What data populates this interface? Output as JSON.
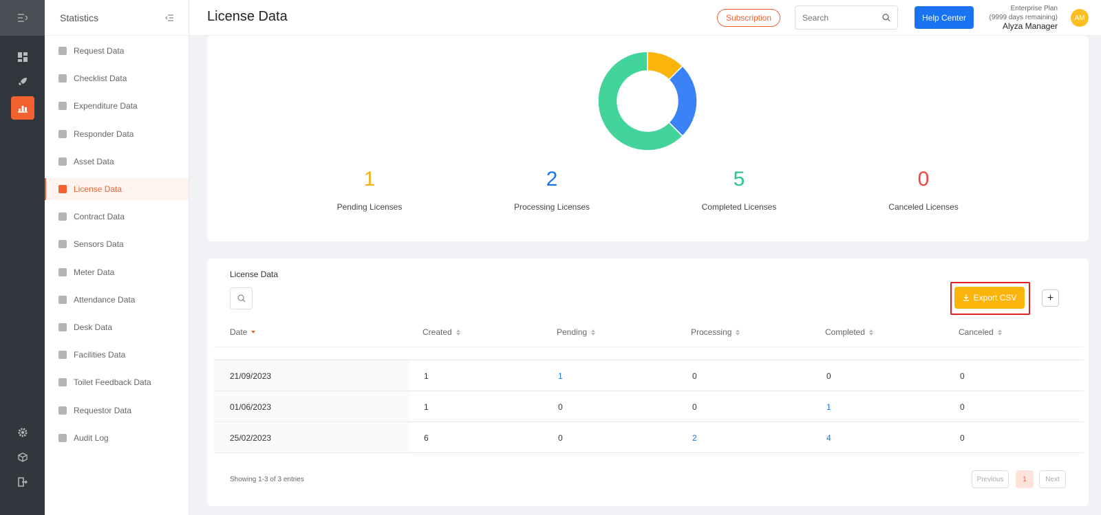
{
  "rail": {
    "icons": [
      "menu-unfold-icon",
      "dashboard-icon",
      "rocket-icon",
      "statistics-icon",
      "settings-icon",
      "cube-icon",
      "logout-icon"
    ]
  },
  "sidebar": {
    "title": "Statistics",
    "items": [
      {
        "label": "Request Data",
        "icon": "question-square-icon"
      },
      {
        "label": "Checklist Data",
        "icon": "checklist-icon"
      },
      {
        "label": "Expenditure Data",
        "icon": "wallet-icon"
      },
      {
        "label": "Responder Data",
        "icon": "users-icon"
      },
      {
        "label": "Asset Data",
        "icon": "box-icon"
      },
      {
        "label": "License Data",
        "icon": "shield-icon",
        "active": true
      },
      {
        "label": "Contract Data",
        "icon": "contract-icon"
      },
      {
        "label": "Sensors Data",
        "icon": "rss-icon"
      },
      {
        "label": "Meter Data",
        "icon": "gauge-icon"
      },
      {
        "label": "Attendance Data",
        "icon": "calendar-check-icon"
      },
      {
        "label": "Desk Data",
        "icon": "desk-icon"
      },
      {
        "label": "Facilities Data",
        "icon": "calendar-plus-icon"
      },
      {
        "label": "Toilet Feedback Data",
        "icon": "list-icon"
      },
      {
        "label": "Requestor Data",
        "icon": "smile-icon"
      },
      {
        "label": "Audit Log",
        "icon": "document-icon"
      }
    ]
  },
  "header": {
    "title": "License Data",
    "subscription_label": "Subscription",
    "search_placeholder": "Search",
    "help_label": "Help Center",
    "plan_name": "Enterprise Plan",
    "plan_days": "(9999 days remaining)",
    "user_name": "Alyza Manager",
    "avatar_initials": "AM"
  },
  "chart_data": {
    "type": "pie",
    "donut": true,
    "categories": [
      "Pending Licenses",
      "Processing Licenses",
      "Completed Licenses",
      "Canceled Licenses"
    ],
    "values": [
      1,
      2,
      5,
      0
    ],
    "colors": [
      "#fbb40b",
      "#3b82f6",
      "#42d49a",
      "#ef4444"
    ]
  },
  "stats": [
    {
      "value": "1",
      "label": "Pending Licenses",
      "color": "#f5b014"
    },
    {
      "value": "2",
      "label": "Processing Licenses",
      "color": "#1a73f0"
    },
    {
      "value": "5",
      "label": "Completed Licenses",
      "color": "#2fc48d"
    },
    {
      "value": "0",
      "label": "Canceled Licenses",
      "color": "#ef4444"
    }
  ],
  "table": {
    "title": "License Data",
    "export_label": "Export CSV",
    "plus_label": "+",
    "columns": [
      "Date",
      "Created",
      "Pending",
      "Processing",
      "Completed",
      "Canceled"
    ],
    "rows": [
      {
        "date": "21/09/2023",
        "created": "1",
        "pending": "1",
        "processing": "0",
        "completed": "0",
        "canceled": "0"
      },
      {
        "date": "01/06/2023",
        "created": "1",
        "pending": "0",
        "processing": "0",
        "completed": "1",
        "canceled": "0"
      },
      {
        "date": "25/02/2023",
        "created": "6",
        "pending": "0",
        "processing": "2",
        "completed": "4",
        "canceled": "0"
      }
    ],
    "showing": "Showing 1-3 of 3 entries",
    "pagination": {
      "previous": "Previous",
      "current": "1",
      "next": "Next"
    }
  }
}
